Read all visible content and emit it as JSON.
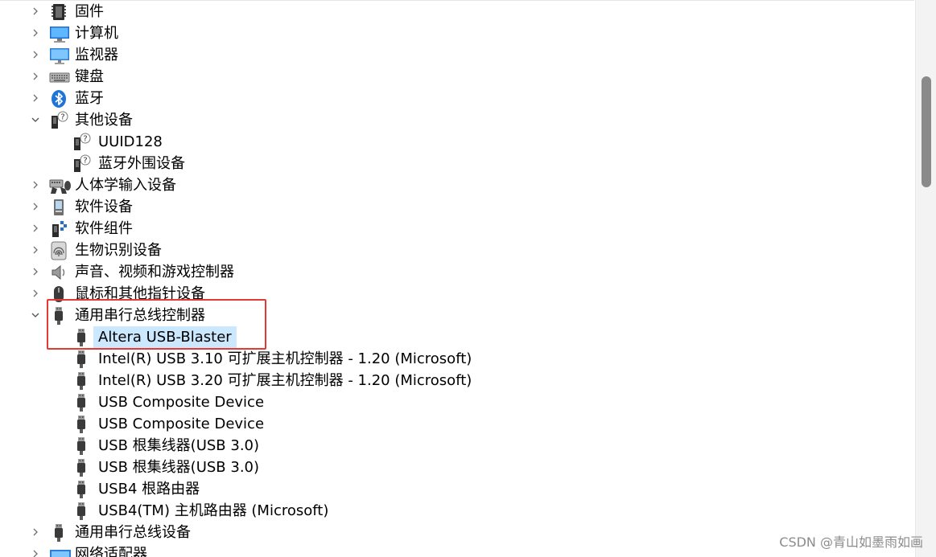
{
  "tree": [
    {
      "label": "固件",
      "level": 0,
      "toggle": "collapsed",
      "icon": "firmware-icon"
    },
    {
      "label": "计算机",
      "level": 0,
      "toggle": "collapsed",
      "icon": "computer-icon"
    },
    {
      "label": "监视器",
      "level": 0,
      "toggle": "collapsed",
      "icon": "monitor-icon"
    },
    {
      "label": "键盘",
      "level": 0,
      "toggle": "collapsed",
      "icon": "keyboard-icon"
    },
    {
      "label": "蓝牙",
      "level": 0,
      "toggle": "collapsed",
      "icon": "bluetooth-icon"
    },
    {
      "label": "其他设备",
      "level": 0,
      "toggle": "expanded",
      "icon": "unknown-device-icon"
    },
    {
      "label": "UUID128",
      "level": 1,
      "toggle": "none",
      "icon": "unknown-device-icon"
    },
    {
      "label": "蓝牙外围设备",
      "level": 1,
      "toggle": "none",
      "icon": "unknown-device-icon"
    },
    {
      "label": "人体学输入设备",
      "level": 0,
      "toggle": "collapsed",
      "icon": "hid-icon"
    },
    {
      "label": "软件设备",
      "level": 0,
      "toggle": "collapsed",
      "icon": "software-device-icon"
    },
    {
      "label": "软件组件",
      "level": 0,
      "toggle": "collapsed",
      "icon": "software-component-icon"
    },
    {
      "label": "生物识别设备",
      "level": 0,
      "toggle": "collapsed",
      "icon": "fingerprint-icon"
    },
    {
      "label": "声音、视频和游戏控制器",
      "level": 0,
      "toggle": "collapsed",
      "icon": "speaker-icon"
    },
    {
      "label": "鼠标和其他指针设备",
      "level": 0,
      "toggle": "collapsed",
      "icon": "mouse-icon"
    },
    {
      "label": "通用串行总线控制器",
      "level": 0,
      "toggle": "expanded",
      "icon": "usb-plug-icon"
    },
    {
      "label": "Altera USB-Blaster",
      "level": 1,
      "toggle": "none",
      "icon": "usb-plug-icon",
      "selected": true
    },
    {
      "label": "Intel(R) USB 3.10 可扩展主机控制器 - 1.20 (Microsoft)",
      "level": 1,
      "toggle": "none",
      "icon": "usb-plug-icon"
    },
    {
      "label": "Intel(R) USB 3.20 可扩展主机控制器 - 1.20 (Microsoft)",
      "level": 1,
      "toggle": "none",
      "icon": "usb-plug-icon"
    },
    {
      "label": "USB Composite Device",
      "level": 1,
      "toggle": "none",
      "icon": "usb-plug-icon"
    },
    {
      "label": "USB Composite Device",
      "level": 1,
      "toggle": "none",
      "icon": "usb-plug-icon"
    },
    {
      "label": "USB 根集线器(USB 3.0)",
      "level": 1,
      "toggle": "none",
      "icon": "usb-plug-icon"
    },
    {
      "label": "USB 根集线器(USB 3.0)",
      "level": 1,
      "toggle": "none",
      "icon": "usb-plug-icon"
    },
    {
      "label": "USB4 根路由器",
      "level": 1,
      "toggle": "none",
      "icon": "usb-plug-icon"
    },
    {
      "label": "USB4(TM) 主机路由器 (Microsoft)",
      "level": 1,
      "toggle": "none",
      "icon": "usb-plug-icon"
    },
    {
      "label": "通用串行总线设备",
      "level": 0,
      "toggle": "collapsed",
      "icon": "usb-plug-icon"
    },
    {
      "label": "网络适配器",
      "level": 0,
      "toggle": "collapsed",
      "icon": "network-adapter-icon"
    }
  ],
  "watermark": "CSDN @青山如墨雨如画",
  "colors": {
    "selection": "#cce8ff",
    "highlight_box": "#e53935",
    "toggle": "#606060",
    "scrollbar_thumb": "#8a8a8a"
  }
}
